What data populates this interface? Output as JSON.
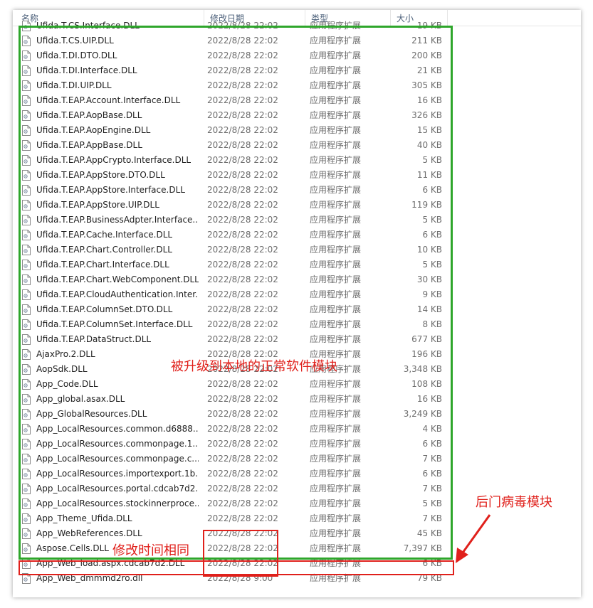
{
  "header": {
    "name": "名称",
    "date": "修改日期",
    "type": "类型",
    "size": "大小"
  },
  "files": [
    {
      "name": "Ufida.T.CS.Interface.DLL",
      "date": "2022/8/28 22:02",
      "type": "应用程序扩展",
      "size": "19 KB"
    },
    {
      "name": "Ufida.T.CS.UIP.DLL",
      "date": "2022/8/28 22:02",
      "type": "应用程序扩展",
      "size": "211 KB"
    },
    {
      "name": "Ufida.T.DI.DTO.DLL",
      "date": "2022/8/28 22:02",
      "type": "应用程序扩展",
      "size": "200 KB"
    },
    {
      "name": "Ufida.T.DI.Interface.DLL",
      "date": "2022/8/28 22:02",
      "type": "应用程序扩展",
      "size": "21 KB"
    },
    {
      "name": "Ufida.T.DI.UIP.DLL",
      "date": "2022/8/28 22:02",
      "type": "应用程序扩展",
      "size": "305 KB"
    },
    {
      "name": "Ufida.T.EAP.Account.Interface.DLL",
      "date": "2022/8/28 22:02",
      "type": "应用程序扩展",
      "size": "16 KB"
    },
    {
      "name": "Ufida.T.EAP.AopBase.DLL",
      "date": "2022/8/28 22:02",
      "type": "应用程序扩展",
      "size": "326 KB"
    },
    {
      "name": "Ufida.T.EAP.AopEngine.DLL",
      "date": "2022/8/28 22:02",
      "type": "应用程序扩展",
      "size": "15 KB"
    },
    {
      "name": "Ufida.T.EAP.AppBase.DLL",
      "date": "2022/8/28 22:02",
      "type": "应用程序扩展",
      "size": "40 KB"
    },
    {
      "name": "Ufida.T.EAP.AppCrypto.Interface.DLL",
      "date": "2022/8/28 22:02",
      "type": "应用程序扩展",
      "size": "5 KB"
    },
    {
      "name": "Ufida.T.EAP.AppStore.DTO.DLL",
      "date": "2022/8/28 22:02",
      "type": "应用程序扩展",
      "size": "11 KB"
    },
    {
      "name": "Ufida.T.EAP.AppStore.Interface.DLL",
      "date": "2022/8/28 22:02",
      "type": "应用程序扩展",
      "size": "6 KB"
    },
    {
      "name": "Ufida.T.EAP.AppStore.UIP.DLL",
      "date": "2022/8/28 22:02",
      "type": "应用程序扩展",
      "size": "119 KB"
    },
    {
      "name": "Ufida.T.EAP.BusinessAdpter.Interface...",
      "date": "2022/8/28 22:02",
      "type": "应用程序扩展",
      "size": "5 KB"
    },
    {
      "name": "Ufida.T.EAP.Cache.Interface.DLL",
      "date": "2022/8/28 22:02",
      "type": "应用程序扩展",
      "size": "6 KB"
    },
    {
      "name": "Ufida.T.EAP.Chart.Controller.DLL",
      "date": "2022/8/28 22:02",
      "type": "应用程序扩展",
      "size": "10 KB"
    },
    {
      "name": "Ufida.T.EAP.Chart.Interface.DLL",
      "date": "2022/8/28 22:02",
      "type": "应用程序扩展",
      "size": "5 KB"
    },
    {
      "name": "Ufida.T.EAP.Chart.WebComponent.DLL",
      "date": "2022/8/28 22:02",
      "type": "应用程序扩展",
      "size": "30 KB"
    },
    {
      "name": "Ufida.T.EAP.CloudAuthentication.Inter...",
      "date": "2022/8/28 22:02",
      "type": "应用程序扩展",
      "size": "9 KB"
    },
    {
      "name": "Ufida.T.EAP.ColumnSet.DTO.DLL",
      "date": "2022/8/28 22:02",
      "type": "应用程序扩展",
      "size": "14 KB"
    },
    {
      "name": "Ufida.T.EAP.ColumnSet.Interface.DLL",
      "date": "2022/8/28 22:02",
      "type": "应用程序扩展",
      "size": "8 KB"
    },
    {
      "name": "Ufida.T.EAP.DataStruct.DLL",
      "date": "2022/8/28 22:02",
      "type": "应用程序扩展",
      "size": "677 KB"
    },
    {
      "name": "AjaxPro.2.DLL",
      "date": "2022/8/28 22:02",
      "type": "应用程序扩展",
      "size": "196 KB"
    },
    {
      "name": "AopSdk.DLL",
      "date": "2022/8/28 22:02",
      "type": "应用程序扩展",
      "size": "3,348 KB"
    },
    {
      "name": "App_Code.DLL",
      "date": "2022/8/28 22:02",
      "type": "应用程序扩展",
      "size": "108 KB"
    },
    {
      "name": "App_global.asax.DLL",
      "date": "2022/8/28 22:02",
      "type": "应用程序扩展",
      "size": "16 KB"
    },
    {
      "name": "App_GlobalResources.DLL",
      "date": "2022/8/28 22:02",
      "type": "应用程序扩展",
      "size": "3,249 KB"
    },
    {
      "name": "App_LocalResources.common.d6888...",
      "date": "2022/8/28 22:02",
      "type": "应用程序扩展",
      "size": "4 KB"
    },
    {
      "name": "App_LocalResources.commonpage.1...",
      "date": "2022/8/28 22:02",
      "type": "应用程序扩展",
      "size": "6 KB"
    },
    {
      "name": "App_LocalResources.commonpage.c...",
      "date": "2022/8/28 22:02",
      "type": "应用程序扩展",
      "size": "7 KB"
    },
    {
      "name": "App_LocalResources.importexport.1b...",
      "date": "2022/8/28 22:02",
      "type": "应用程序扩展",
      "size": "6 KB"
    },
    {
      "name": "App_LocalResources.portal.cdcab7d2...",
      "date": "2022/8/28 22:02",
      "type": "应用程序扩展",
      "size": "7 KB"
    },
    {
      "name": "App_LocalResources.stockinnerproce...",
      "date": "2022/8/28 22:02",
      "type": "应用程序扩展",
      "size": "5 KB"
    },
    {
      "name": "App_Theme_Ufida.DLL",
      "date": "2022/8/28 22:02",
      "type": "应用程序扩展",
      "size": "7 KB"
    },
    {
      "name": "App_WebReferences.DLL",
      "date": "2022/8/28 22:02",
      "type": "应用程序扩展",
      "size": "45 KB"
    },
    {
      "name": "Aspose.Cells.DLL",
      "date": "2022/8/28 22:02",
      "type": "应用程序扩展",
      "size": "7,397 KB"
    },
    {
      "name": "App_Web_load.aspx.cdcab7d2.DLL",
      "date": "2022/8/28 22:02",
      "type": "应用程序扩展",
      "size": "6 KB"
    },
    {
      "name": "App_Web_dmmmd2ro.dll",
      "date": "2022/8/28 9:00",
      "type": "应用程序扩展",
      "size": "79 KB"
    }
  ],
  "annotations": {
    "normal_modules": "被升级到本地的正常软件模块",
    "backdoor": "后门病毒模块",
    "same_time": "修改时间相同"
  },
  "colors": {
    "green_box": "#2ea62b",
    "red_box": "#e0201b"
  }
}
